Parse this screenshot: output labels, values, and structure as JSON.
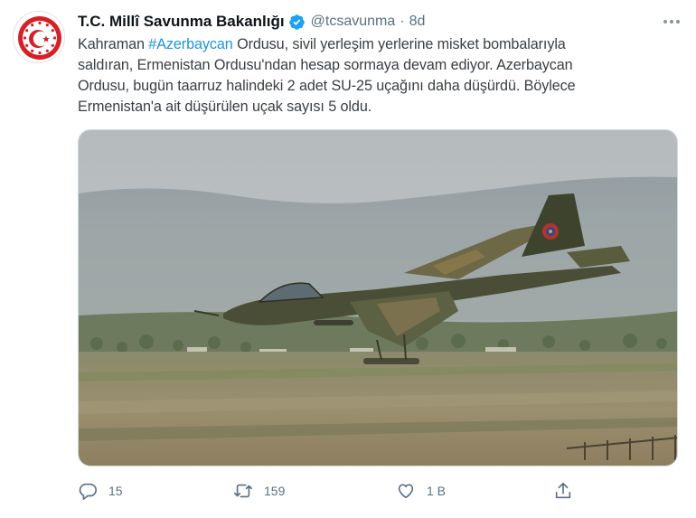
{
  "account": {
    "name": "T.C. Millî Savunma Bakanlığı",
    "handle": "@tcsavunma",
    "separator": "·",
    "timestamp": "8d"
  },
  "tweet": {
    "text_before_hashtag": "Kahraman ",
    "hashtag": "#Azerbaycan",
    "text_after_hashtag": " Ordusu, sivil yerleşim yerlerine misket bombalarıyla",
    "lines": [
      "saldıran, Ermenistan Ordusu'ndan hesap sormaya devam ediyor. Azerbaycan",
      "Ordusu, bugün taarruz halindeki 2 adet SU-25 uçağını daha düşürdü. Böylece",
      "Ermenistan'a ait düşürülen uçak sayısı 5 oldu."
    ]
  },
  "actions": {
    "replies": "15",
    "retweets": "159",
    "likes": "1 B"
  },
  "icons": {
    "avatar": "ministry-seal-icon",
    "verified": "verified-badge-icon",
    "more": "more-options-icon",
    "reply": "reply-icon",
    "retweet": "retweet-icon",
    "like": "heart-icon",
    "share": "share-icon"
  },
  "colors": {
    "hashtag": "#1b95e0",
    "verified": "#1da1f2",
    "seal": "#d61f26",
    "secondary_text": "#5b7083"
  }
}
